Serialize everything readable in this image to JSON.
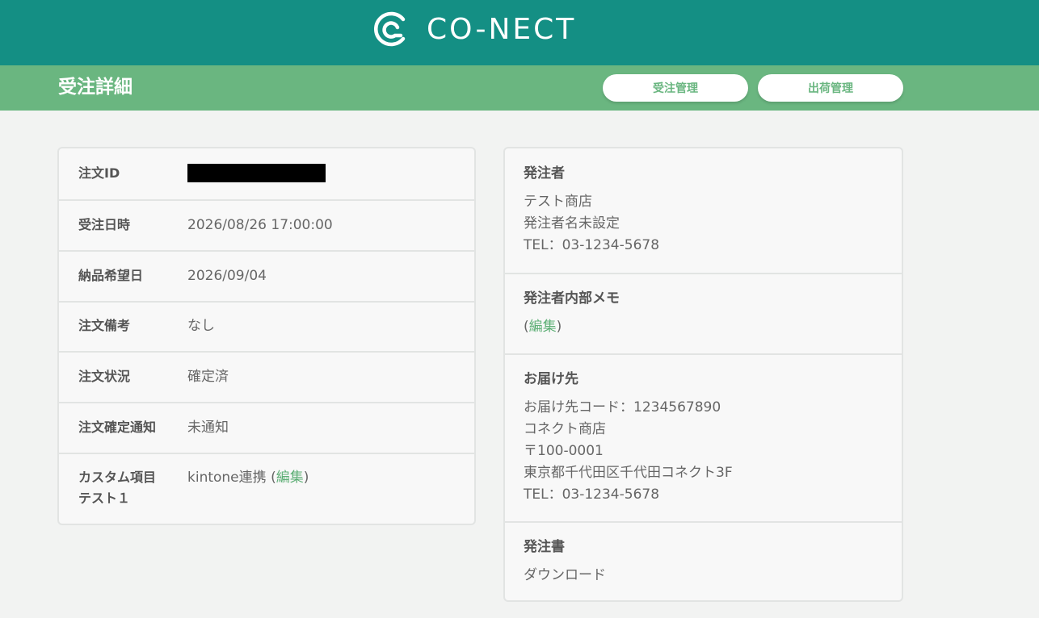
{
  "header": {
    "brand": "CO-NECT",
    "brand_color": "#148f84",
    "logo_icon": "conect-logo-icon"
  },
  "subheader": {
    "title": "受注詳細",
    "bar_color": "#6ab680",
    "buttons": {
      "order_management": "受注管理",
      "shipping_management": "出荷管理"
    }
  },
  "order": {
    "rows": [
      {
        "label": "注文ID",
        "value": ""
      },
      {
        "label": "受注日時",
        "value": "2026/08/26 17:00:00"
      },
      {
        "label": "納品希望日",
        "value": "2026/09/04"
      },
      {
        "label": "注文備考",
        "value": "なし"
      },
      {
        "label": "注文状況",
        "value": "確定済"
      },
      {
        "label": "注文確定通知",
        "value": "未通知"
      }
    ],
    "custom": {
      "label_line1": "カスタム項目",
      "label_line2": "テスト１",
      "value": "kintone連携",
      "paren_open": "(",
      "edit_link": "編集",
      "paren_close": ")"
    }
  },
  "orderer": {
    "heading": "発注者",
    "lines": [
      "テスト商店",
      "発注者名未設定",
      "TEL：03-1234-5678"
    ]
  },
  "memo": {
    "heading": "発注者内部メモ",
    "paren_open": "(",
    "edit_link": "編集",
    "paren_close": ")"
  },
  "delivery": {
    "heading": "お届け先",
    "lines": [
      "お届け先コード：1234567890",
      "コネクト商店",
      "〒100-0001",
      "東京都千代田区千代田コネクト3F",
      "TEL：03-1234-5678"
    ]
  },
  "purchase_order": {
    "heading": "発注書",
    "download_link": "ダウンロード"
  }
}
